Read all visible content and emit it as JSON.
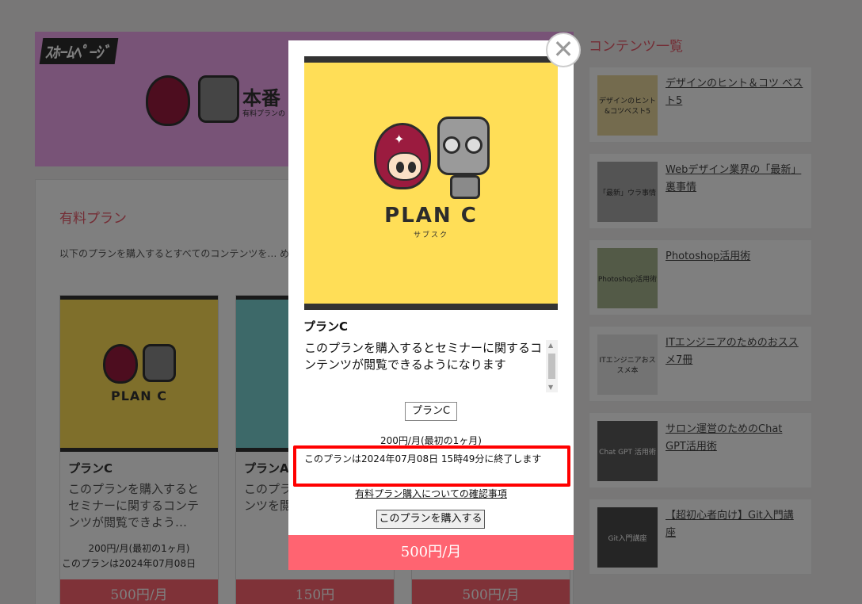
{
  "background": {
    "logo_text": "ｽﾎｰﾑﾍﾟｰｼﾞ",
    "banner_text": "本番",
    "banner_sub": "有料プランの",
    "section_title": "有料プラン",
    "section_desc": "以下のプランを購入するとすべてのコンテンツを… めにメンバー登録をお願いします。",
    "plans": [
      {
        "thumb_text": "PLAN C",
        "name": "プランC",
        "desc": "このプランを購入するとセミナーに関するコンテンツが閲覧できよう…",
        "price": "200円/月(最初の1ヶ月)",
        "end": "このプランは2024年07月08日",
        "button": "500円/月"
      },
      {
        "thumb_text": "",
        "name": "プランA",
        "desc": "このプラン… デザイン… ンツを閲…",
        "price": "",
        "end": "",
        "button": "150円"
      },
      {
        "thumb_text": "",
        "name": "",
        "desc": "",
        "price": "",
        "end": "",
        "button": "500円/月"
      }
    ],
    "sidebar_title": "コンテンツ一覧",
    "sidebar_items": [
      {
        "thumb": "デザインのヒント&コツベスト5",
        "label": "デザインのヒント＆コツ ベスト5"
      },
      {
        "thumb": "「最新」ウラ事情",
        "label": "Webデザイン業界の「最新」裏事情"
      },
      {
        "thumb": "Photoshop活用術",
        "label": "Photoshop活用術"
      },
      {
        "thumb": "ITエンジニアおススメ本",
        "label": "ITエンジニアのためのおススメ7冊"
      },
      {
        "thumb": "Chat GPT 活用術",
        "label": "サロン運営のためのChat GPT活用術"
      },
      {
        "thumb": "Git入門講座",
        "label": "【超初心者向け】Git入門講座"
      }
    ]
  },
  "modal": {
    "close_symbol": "✕",
    "image": {
      "logo": "PLAN C",
      "sub": "サブスク"
    },
    "plan_name": "プランC",
    "description": "このプランを購入するとセミナーに関するコンテンツが閲覧できるようになります",
    "plan_select_value": "プランC",
    "price_text": "200円/月(最初の1ヶ月)",
    "end_text": "このプランは2024年07月08日 15時49分に終了します",
    "confirm_link": "有料プラン購入についての確認事項",
    "buy_button": "このプランを購入する",
    "price_bar": "500円/月"
  }
}
